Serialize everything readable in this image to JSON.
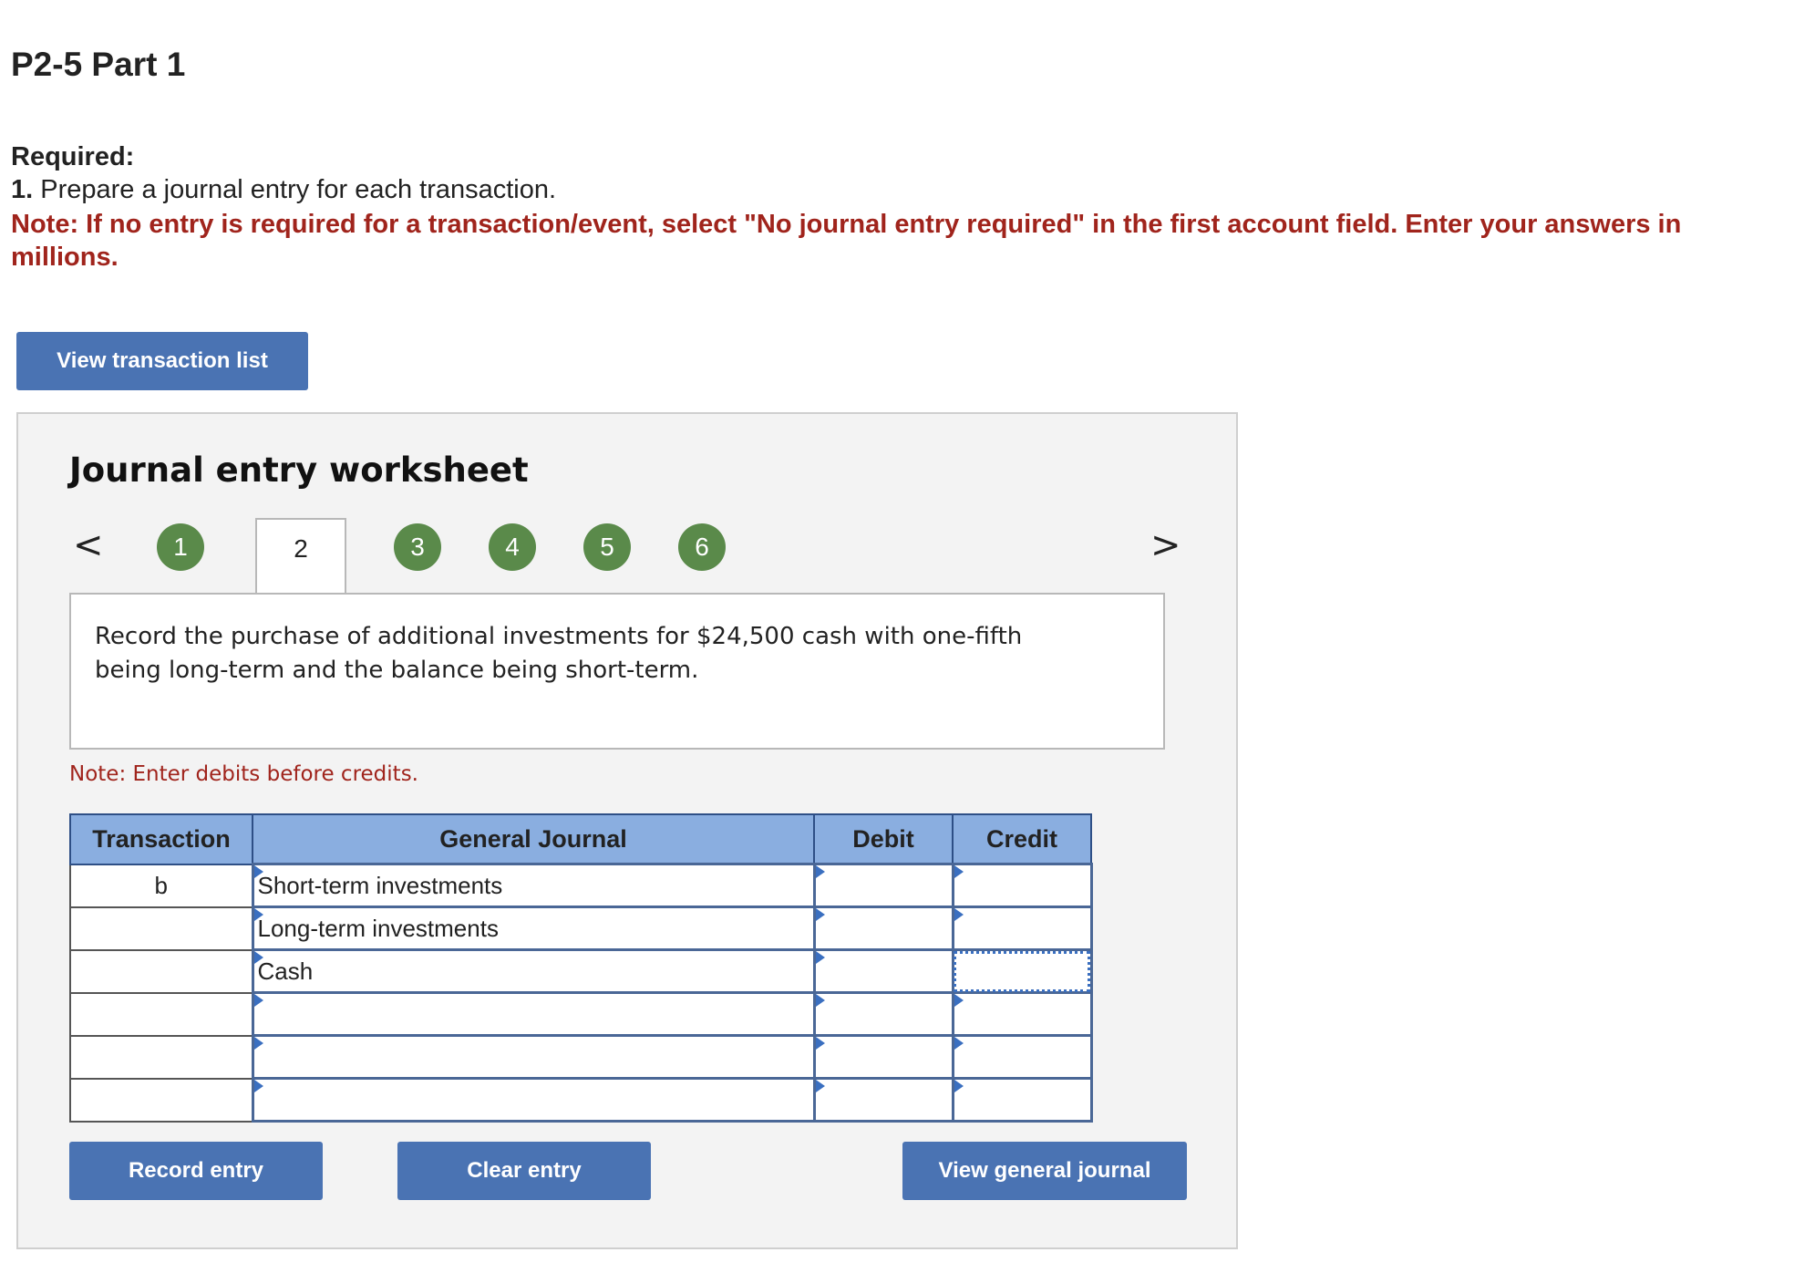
{
  "header": {
    "title": "P2-5 Part 1"
  },
  "required": {
    "heading": "Required:",
    "item_number": "1.",
    "item_text": "Prepare a journal entry for each transaction.",
    "note": "Note: If no entry is required for a transaction/event, select \"No journal entry required\" in the first account field. Enter your answers in millions."
  },
  "buttons": {
    "view_transaction_list": "View transaction list",
    "record_entry": "Record entry",
    "clear_entry": "Clear entry",
    "view_general_journal": "View general journal"
  },
  "worksheet": {
    "title": "Journal entry worksheet",
    "prev_arrow": "<",
    "next_arrow": ">",
    "tabs": [
      "1",
      "2",
      "3",
      "4",
      "5",
      "6"
    ],
    "active_tab": "2",
    "description": "Record the purchase of additional investments for $24,500 cash with one-fifth being long-term and the balance being short-term.",
    "note": "Note: Enter debits before credits."
  },
  "journal": {
    "headers": {
      "transaction": "Transaction",
      "general_journal": "General Journal",
      "debit": "Debit",
      "credit": "Credit"
    },
    "rows": [
      {
        "transaction": "b",
        "account": "Short-term investments",
        "debit": "",
        "credit": ""
      },
      {
        "transaction": "",
        "account": "Long-term investments",
        "debit": "",
        "credit": ""
      },
      {
        "transaction": "",
        "account": "Cash",
        "debit": "",
        "credit": ""
      },
      {
        "transaction": "",
        "account": "",
        "debit": "",
        "credit": ""
      },
      {
        "transaction": "",
        "account": "",
        "debit": "",
        "credit": ""
      },
      {
        "transaction": "",
        "account": "",
        "debit": "",
        "credit": ""
      }
    ]
  },
  "colors": {
    "button_bg": "#4a73b3",
    "header_bg": "#8aaee0",
    "note_red": "#a0241c",
    "step_green": "#5a8a4a"
  }
}
